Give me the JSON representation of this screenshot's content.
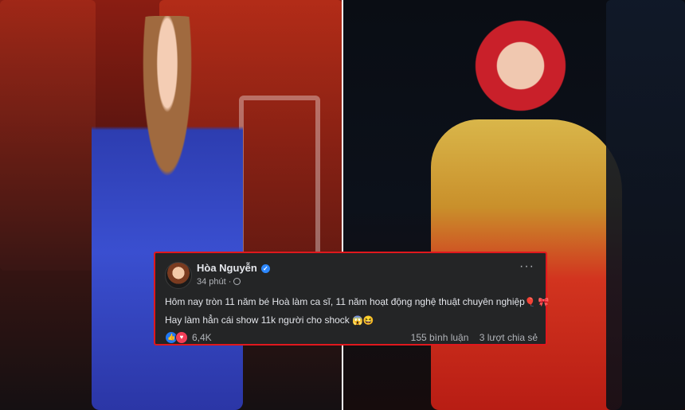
{
  "post": {
    "author": "Hòa Nguyễn",
    "time": "34 phút ·",
    "line1": "Hôm nay tròn 11 năm bé Hoà làm ca sĩ, 11 năm hoạt động nghệ thuật chuyên nghiệp",
    "line1_emojis": "🎈 🎀",
    "line2": "Hay làm hẳn cái show 11k người cho shock",
    "line2_emojis": "😱😆",
    "reaction_count": "6,4K",
    "comments": "155 bình luận",
    "shares": "3 lượt chia sẻ",
    "icons": {
      "verified": "verified-badge-icon",
      "privacy": "globe-icon",
      "more": "more-options-icon",
      "like": "like-reaction-icon",
      "love": "love-reaction-icon"
    }
  },
  "colors": {
    "card_bg": "#242526",
    "card_border": "#e0181d",
    "text_primary": "#e4e6eb",
    "text_secondary": "#b0b3b8",
    "like_blue": "#2078f4",
    "love_red": "#f33e58"
  }
}
